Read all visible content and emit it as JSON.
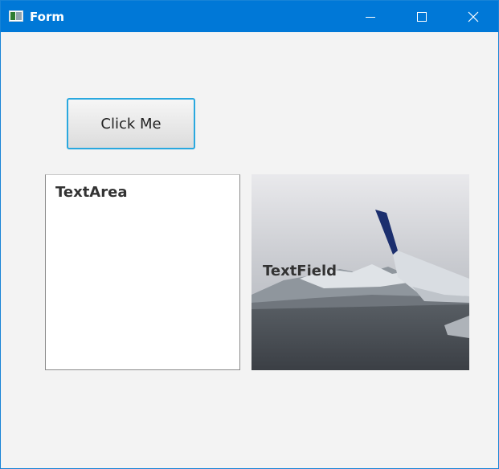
{
  "window": {
    "title": "Form"
  },
  "form": {
    "button_label": "Click Me",
    "textarea_label": "TextArea",
    "textfield_label": "TextField"
  },
  "colors": {
    "titlebar": "#0078d7",
    "button_border": "#29a8df",
    "background": "#f3f3f3"
  },
  "icons": [
    "app-window-icon",
    "minimize-icon",
    "maximize-icon",
    "close-icon"
  ]
}
